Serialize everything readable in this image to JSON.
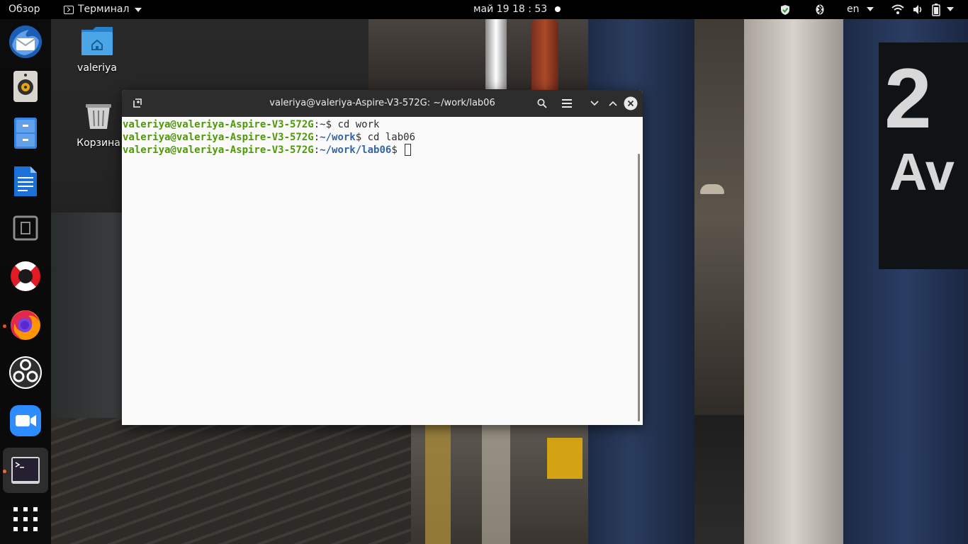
{
  "topbar": {
    "activities": "Обзор",
    "app_menu": "Терминал",
    "clock": "май 19  18 : 53",
    "language": "en"
  },
  "dock": {
    "items": [
      {
        "name": "thunderbird",
        "icon": "thunderbird-icon"
      },
      {
        "name": "rhythmbox",
        "icon": "speaker-icon"
      },
      {
        "name": "files",
        "icon": "file-cabinet-icon"
      },
      {
        "name": "writer",
        "icon": "document-icon"
      },
      {
        "name": "screenshot",
        "icon": "screenshot-icon"
      },
      {
        "name": "help",
        "icon": "lifebuoy-icon"
      },
      {
        "name": "firefox",
        "icon": "firefox-icon"
      },
      {
        "name": "obs",
        "icon": "obs-icon"
      },
      {
        "name": "zoom",
        "icon": "zoom-icon"
      },
      {
        "name": "terminal",
        "icon": "terminal-icon"
      },
      {
        "name": "show-apps",
        "icon": "app-grid-icon"
      }
    ]
  },
  "desktop": {
    "home_label": "valeriya",
    "trash_label": "Корзина"
  },
  "terminal": {
    "title": "valeriya@valeriya-Aspire-V3-572G: ~/work/lab06",
    "lines": [
      {
        "user": "valeriya@valeriya-Aspire-V3-572G",
        "sep": ":",
        "path": "~",
        "prompt": "$ ",
        "cmd": "cd work"
      },
      {
        "user": "valeriya@valeriya-Aspire-V3-572G",
        "sep": ":",
        "path": "~/work",
        "prompt": "$ ",
        "cmd": "cd lab06"
      },
      {
        "user": "valeriya@valeriya-Aspire-V3-572G",
        "sep": ":",
        "path": "~/work/lab06",
        "prompt": "$ ",
        "cmd": ""
      }
    ]
  },
  "colors": {
    "prompt_user": "#4e9a06",
    "prompt_path": "#3465a4",
    "titlebar": "#2d2d2d",
    "running_indicator": "#e9541e"
  }
}
